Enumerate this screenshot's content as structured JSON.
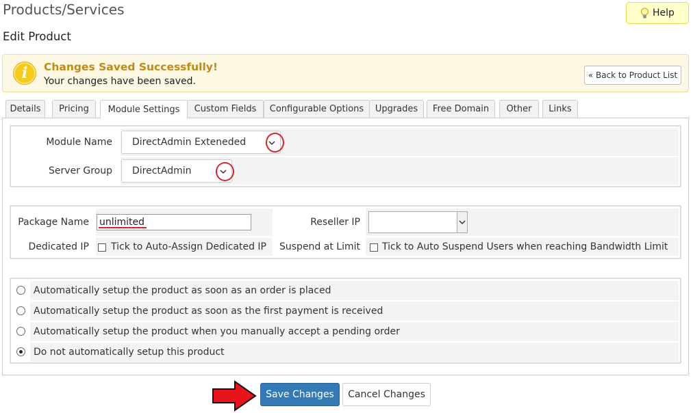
{
  "header": {
    "title": "Products/Services",
    "subtitle": "Edit Product",
    "help_label": "Help"
  },
  "alert": {
    "title": "Changes Saved Successfully!",
    "message": "Your changes have been saved.",
    "icon_glyph": "i",
    "back_label": "« Back to Product List"
  },
  "tabs": [
    {
      "label": "Details"
    },
    {
      "label": "Pricing"
    },
    {
      "label": "Module Settings",
      "active": true
    },
    {
      "label": "Custom Fields"
    },
    {
      "label": "Configurable Options"
    },
    {
      "label": "Upgrades"
    },
    {
      "label": "Free Domain"
    },
    {
      "label": "Other"
    },
    {
      "label": "Links"
    }
  ],
  "module": {
    "module_name_label": "Module Name",
    "module_name_value": "DirectAdmin Exteneded",
    "server_group_label": "Server Group",
    "server_group_value": "DirectAdmin"
  },
  "options": {
    "package_name_label": "Package Name",
    "package_name_value": "unlimited",
    "reseller_ip_label": "Reseller IP",
    "reseller_ip_value": "",
    "dedicated_ip_label": "Dedicated IP",
    "dedicated_ip_text": "Tick to Auto-Assign Dedicated IP",
    "suspend_label": "Suspend at Limit",
    "suspend_text": "Tick to Auto Suspend Users when reaching Bandwidth Limit"
  },
  "setup": {
    "options": [
      {
        "label": "Automatically setup the product as soon as an order is placed",
        "checked": false
      },
      {
        "label": "Automatically setup the product as soon as the first payment is received",
        "checked": false
      },
      {
        "label": "Automatically setup the product when you manually accept a pending order",
        "checked": false
      },
      {
        "label": "Do not automatically setup this product",
        "checked": true
      }
    ]
  },
  "actions": {
    "save_label": "Save Changes",
    "cancel_label": "Cancel Changes"
  },
  "colors": {
    "primary": "#337ab7",
    "alert_bg": "#fcf8e3",
    "alert_title": "#c08a18",
    "annotation": "#d6232d"
  }
}
